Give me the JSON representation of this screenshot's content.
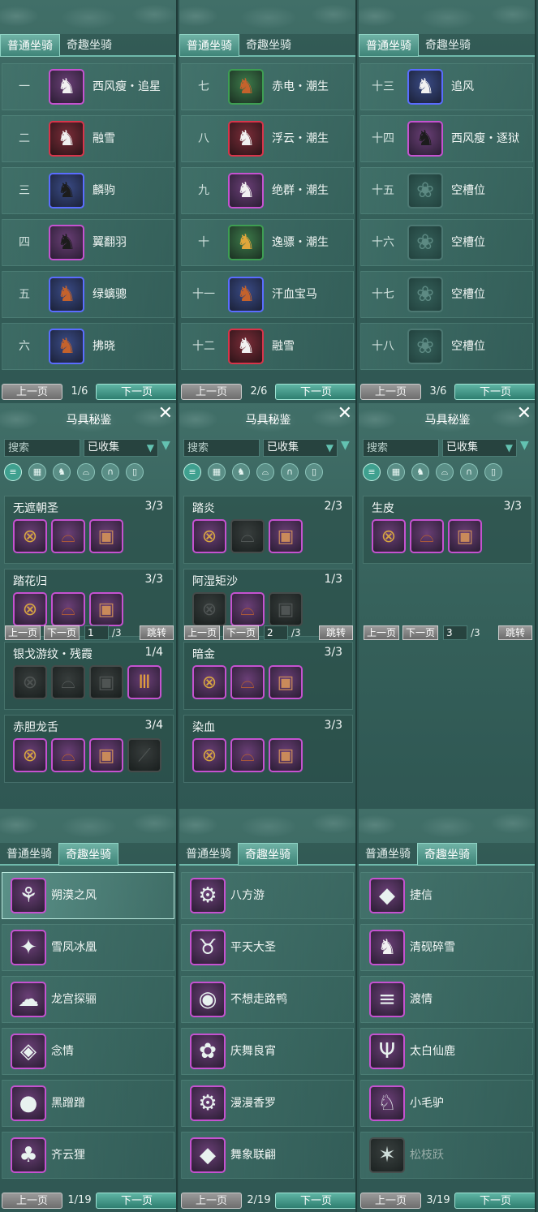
{
  "mounts": {
    "tab_normal": "普通坐骑",
    "tab_fun": "奇趣坐骑",
    "prev": "上一页",
    "next": "下一页",
    "normal_pages": [
      {
        "page": "1/6",
        "rows": [
          {
            "num": "一",
            "name": "西风瘦・追星",
            "icon": "white-horse-icon",
            "quality": "purple"
          },
          {
            "num": "二",
            "name": "融雪",
            "icon": "white-horse-icon",
            "quality": "red"
          },
          {
            "num": "三",
            "name": "麟驹",
            "icon": "black-horse-icon",
            "quality": "blue"
          },
          {
            "num": "四",
            "name": "翼翻羽",
            "icon": "black-horse-icon",
            "quality": "purple"
          },
          {
            "num": "五",
            "name": "绿螭骢",
            "icon": "red-horse-icon",
            "quality": "blue"
          },
          {
            "num": "六",
            "name": "拂晓",
            "icon": "red-horse-icon",
            "quality": "blue"
          }
        ]
      },
      {
        "page": "2/6",
        "rows": [
          {
            "num": "七",
            "name": "赤电・潮生",
            "icon": "red-horse-icon",
            "quality": "green"
          },
          {
            "num": "八",
            "name": "浮云・潮生",
            "icon": "white-horse-icon",
            "quality": "red"
          },
          {
            "num": "九",
            "name": "绝群・潮生",
            "icon": "white-horse-icon",
            "quality": "purple"
          },
          {
            "num": "十",
            "name": "逸骠・潮生",
            "icon": "golden-horse-icon",
            "quality": "green"
          },
          {
            "num": "十一",
            "name": "汗血宝马",
            "icon": "red-horse-icon",
            "quality": "blue"
          },
          {
            "num": "十二",
            "name": "融雪",
            "icon": "white-horse-icon",
            "quality": "red"
          }
        ]
      },
      {
        "page": "3/6",
        "rows": [
          {
            "num": "十三",
            "name": "追风",
            "icon": "white-horse-icon",
            "quality": "blue"
          },
          {
            "num": "十四",
            "name": "西风瘦・逐狱",
            "icon": "black-horse-icon",
            "quality": "purple"
          },
          {
            "num": "十五",
            "name": "空槽位",
            "icon": "empty-slot-icon",
            "quality": "empty"
          },
          {
            "num": "十六",
            "name": "空槽位",
            "icon": "empty-slot-icon",
            "quality": "empty"
          },
          {
            "num": "十七",
            "name": "空槽位",
            "icon": "empty-slot-icon",
            "quality": "empty"
          },
          {
            "num": "十八",
            "name": "空槽位",
            "icon": "empty-slot-icon",
            "quality": "empty"
          }
        ]
      }
    ],
    "fun_pages": [
      {
        "page": "1/19",
        "rows": [
          {
            "name": "朔漠之风",
            "icon": "chariot-icon"
          },
          {
            "name": "雪凤冰凰",
            "icon": "wing-icon"
          },
          {
            "name": "龙宫探骊",
            "icon": "cloud-icon"
          },
          {
            "name": "念情",
            "icon": "jade-icon"
          },
          {
            "name": "黑蹭蹭",
            "icon": "boar-icon"
          },
          {
            "name": "齐云狸",
            "icon": "cat-icon"
          }
        ]
      },
      {
        "page": "2/19",
        "rows": [
          {
            "name": "八方游",
            "icon": "cart-icon"
          },
          {
            "name": "平天大圣",
            "icon": "bull-icon"
          },
          {
            "name": "不想走路鸭",
            "icon": "duck-icon"
          },
          {
            "name": "庆舞良宵",
            "icon": "lion-dance-icon"
          },
          {
            "name": "漫漫香罗",
            "icon": "cart-icon"
          },
          {
            "name": "舞象联翩",
            "icon": "elephant-icon"
          }
        ]
      },
      {
        "page": "3/19",
        "rows": [
          {
            "name": "捷信",
            "icon": "elephant-icon"
          },
          {
            "name": "清砚碎雪",
            "icon": "white-horse-icon"
          },
          {
            "name": "渡情",
            "icon": "bamboo-raft-icon"
          },
          {
            "name": "太白仙鹿",
            "icon": "antler-icon"
          },
          {
            "name": "小毛驴",
            "icon": "donkey-icon"
          },
          {
            "name": "松枝跃",
            "icon": "squirrel-icon",
            "locked": true
          }
        ]
      }
    ]
  },
  "codex": {
    "title": "马具秘鉴",
    "search_placeholder": "搜索",
    "filter_value": "已收集",
    "categories": [
      "list-icon",
      "grid-icon",
      "horse-head-icon",
      "saddle-icon",
      "horseshoe-icon",
      "shield-icon"
    ],
    "prev": "上一页",
    "next": "下一页",
    "jump": "跳转",
    "total": "/3",
    "pages": [
      {
        "page": "1",
        "sets": [
          {
            "name": "无遮朝圣",
            "count": "3/3",
            "items": [
              "bridle",
              "saddle",
              "armor"
            ]
          },
          {
            "name": "踏花归",
            "count": "3/3",
            "items": [
              "bridle",
              "saddle",
              "armor"
            ]
          },
          {
            "name": "银戈游纹・残霞",
            "count": "1/4",
            "items": [
              "bridle",
              "saddle",
              "armor",
              "stirrup"
            ],
            "have": [
              false,
              false,
              false,
              true
            ]
          },
          {
            "name": "赤胆龙舌",
            "count": "3/4",
            "items": [
              "bridle",
              "saddle",
              "armor",
              "tassel"
            ],
            "have": [
              true,
              true,
              true,
              false
            ]
          }
        ]
      },
      {
        "page": "2",
        "sets": [
          {
            "name": "踏炎",
            "count": "2/3",
            "items": [
              "bridle",
              "saddle",
              "armor"
            ],
            "have": [
              true,
              false,
              true
            ]
          },
          {
            "name": "阿湿矩沙",
            "count": "1/3",
            "items": [
              "bridle",
              "saddle",
              "armor"
            ],
            "have": [
              false,
              true,
              false
            ]
          },
          {
            "name": "暗金",
            "count": "3/3",
            "items": [
              "bridle",
              "saddle",
              "armor"
            ]
          },
          {
            "name": "染血",
            "count": "3/3",
            "items": [
              "bridle",
              "saddle",
              "armor"
            ]
          }
        ]
      },
      {
        "page": "3",
        "sets": [
          {
            "name": "生皮",
            "count": "3/3",
            "items": [
              "bridle",
              "saddle",
              "armor"
            ]
          }
        ]
      }
    ]
  }
}
